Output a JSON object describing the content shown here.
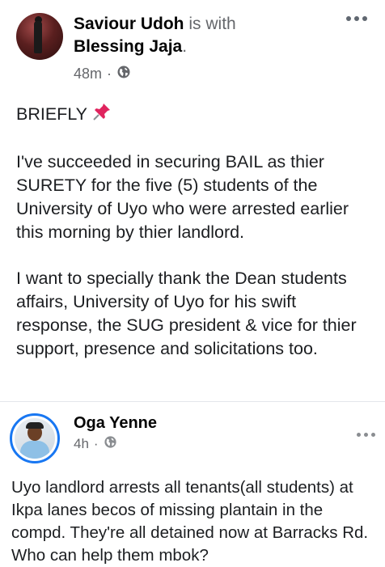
{
  "post": {
    "author": "Saviour Udoh",
    "with_text": "is with",
    "tagged": "Blessing Jaja",
    "tagged_suffix": ".",
    "time": "48m",
    "separator": "·",
    "privacy_icon": "globe-icon",
    "paragraphs": [
      "BRIEFLY",
      "I've succeeded in securing BAIL as thier SURETY for the five (5) students of the University of Uyo who were arrested earlier this morning by thier landlord.",
      "I want to specially thank the Dean students affairs, University of Uyo for his swift response, the SUG president & vice for thier support, presence and solicitations too."
    ],
    "pin_icon": "pushpin-icon"
  },
  "shared": {
    "author": "Oga Yenne",
    "time": "4h",
    "separator": "·",
    "privacy_icon": "globe-icon",
    "text": "Uyo landlord arrests all tenants(all students) at Ikpa lanes becos of missing plantain in the compd. They're all detained now at Barracks Rd. Who can help them mbok?"
  },
  "colors": {
    "accent": "#1877f2",
    "secondary_text": "#65676b",
    "primary_text": "#1c1e21"
  }
}
